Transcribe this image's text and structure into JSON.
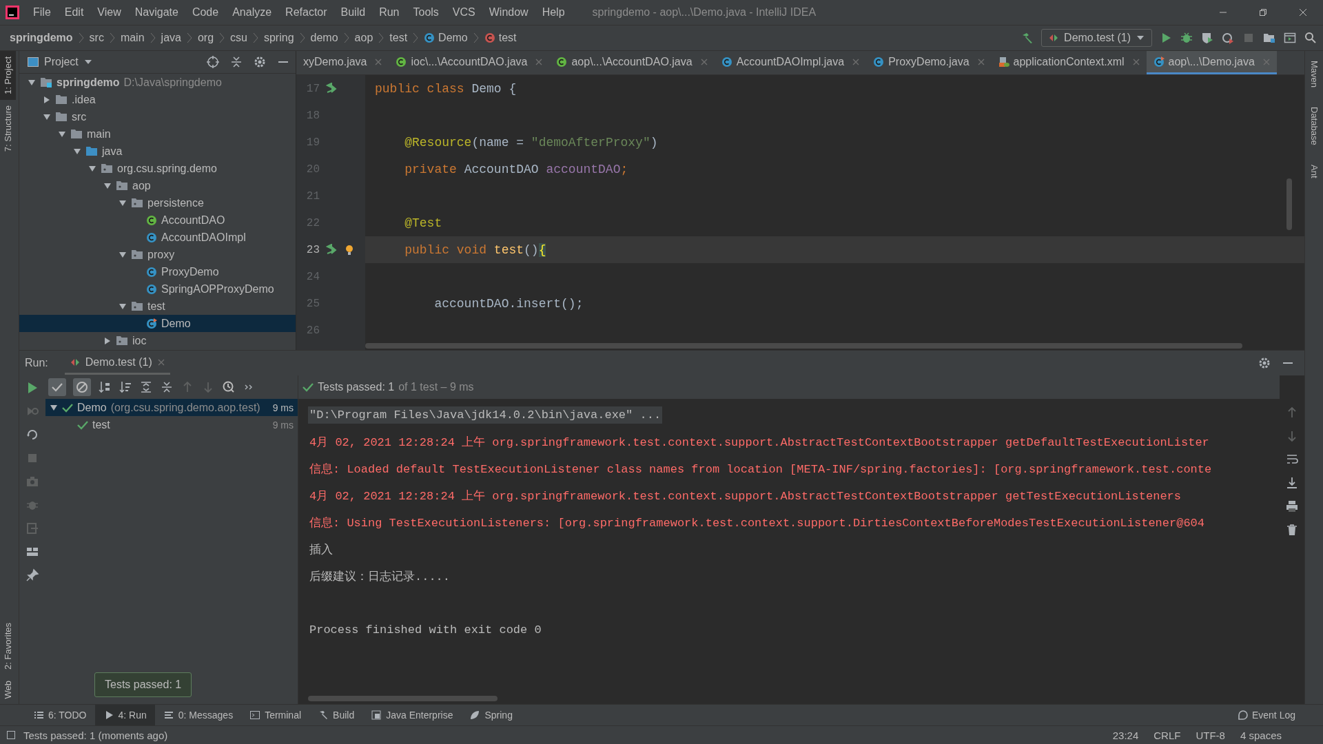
{
  "window": {
    "title": "springdemo - aop\\...\\Demo.java - IntelliJ IDEA"
  },
  "menu": [
    "File",
    "Edit",
    "View",
    "Navigate",
    "Code",
    "Analyze",
    "Refactor",
    "Build",
    "Run",
    "Tools",
    "VCS",
    "Window",
    "Help"
  ],
  "breadcrumbs": [
    {
      "label": "springdemo",
      "kind": "text"
    },
    {
      "label": "src",
      "kind": "text"
    },
    {
      "label": "main",
      "kind": "text"
    },
    {
      "label": "java",
      "kind": "text"
    },
    {
      "label": "org",
      "kind": "text"
    },
    {
      "label": "csu",
      "kind": "text"
    },
    {
      "label": "spring",
      "kind": "text"
    },
    {
      "label": "demo",
      "kind": "text"
    },
    {
      "label": "aop",
      "kind": "text"
    },
    {
      "label": "test",
      "kind": "text"
    },
    {
      "label": "Demo",
      "kind": "class"
    },
    {
      "label": "test",
      "kind": "method"
    }
  ],
  "run_config": "Demo.test (1)",
  "left_tool_windows": [
    {
      "label": "1: Project",
      "selected": true
    },
    {
      "label": "7: Structure",
      "selected": false
    }
  ],
  "left_tool_windows_bottom": [
    {
      "label": "2: Favorites",
      "selected": false
    },
    {
      "label": "Web",
      "selected": false
    }
  ],
  "right_tool_windows": [
    "Maven",
    "Database",
    "Ant"
  ],
  "project": {
    "title": "Project",
    "tree": [
      {
        "label": "springdemo",
        "path": "D:\\Java\\springdemo",
        "kind": "module",
        "expanded": true,
        "selected": false,
        "children": [
          {
            "label": ".idea",
            "kind": "folder",
            "expanded": false,
            "selected": false
          },
          {
            "label": "src",
            "kind": "folder",
            "expanded": true,
            "selected": false,
            "children": [
              {
                "label": "main",
                "kind": "folder",
                "expanded": true,
                "selected": false,
                "children": [
                  {
                    "label": "java",
                    "kind": "source",
                    "expanded": true,
                    "selected": false,
                    "children": [
                      {
                        "label": "org.csu.spring.demo",
                        "kind": "package",
                        "expanded": true,
                        "selected": false,
                        "children": [
                          {
                            "label": "aop",
                            "kind": "package",
                            "expanded": true,
                            "selected": false,
                            "children": [
                              {
                                "label": "persistence",
                                "kind": "package",
                                "expanded": true,
                                "selected": false,
                                "children": [
                                  {
                                    "label": "AccountDAO",
                                    "kind": "interface",
                                    "selected": false
                                  },
                                  {
                                    "label": "AccountDAOImpl",
                                    "kind": "class",
                                    "selected": false
                                  }
                                ]
                              },
                              {
                                "label": "proxy",
                                "kind": "package",
                                "expanded": true,
                                "selected": false,
                                "children": [
                                  {
                                    "label": "ProxyDemo",
                                    "kind": "class",
                                    "selected": false
                                  },
                                  {
                                    "label": "SpringAOPProxyDemo",
                                    "kind": "class",
                                    "selected": false
                                  }
                                ]
                              },
                              {
                                "label": "test",
                                "kind": "package",
                                "expanded": true,
                                "selected": false,
                                "children": [
                                  {
                                    "label": "Demo",
                                    "kind": "testclass",
                                    "selected": true
                                  }
                                ]
                              }
                            ]
                          },
                          {
                            "label": "ioc",
                            "kind": "package",
                            "expanded": false,
                            "selected": false
                          }
                        ]
                      }
                    ]
                  }
                ]
              }
            ]
          }
        ]
      }
    ]
  },
  "editor_tabs": [
    {
      "label": "xyDemo.java",
      "kind": "plain",
      "selected": false
    },
    {
      "label": "ioc\\...\\AccountDAO.java",
      "kind": "interface",
      "selected": false
    },
    {
      "label": "aop\\...\\AccountDAO.java",
      "kind": "interface",
      "selected": false
    },
    {
      "label": "AccountDAOImpl.java",
      "kind": "class",
      "selected": false
    },
    {
      "label": "ProxyDemo.java",
      "kind": "class",
      "selected": false
    },
    {
      "label": "applicationContext.xml",
      "kind": "xml",
      "selected": false
    },
    {
      "label": "aop\\...\\Demo.java",
      "kind": "testclass",
      "selected": true
    }
  ],
  "code_lines": [
    {
      "number": "17",
      "run_marker": true,
      "bulb": false,
      "current": false,
      "tokens": [
        {
          "text": "public class ",
          "kind": "keyword"
        },
        {
          "text": "Demo {",
          "kind": "plain"
        }
      ]
    },
    {
      "number": "18",
      "run_marker": false,
      "bulb": false,
      "current": false
    },
    {
      "number": "19",
      "run_marker": false,
      "bulb": false,
      "current": false,
      "tokens": [
        {
          "text": "    @Resource",
          "kind": "annotation"
        },
        {
          "text": "(name = ",
          "kind": "plain"
        },
        {
          "text": "\"demoAfterProxy\"",
          "kind": "string"
        },
        {
          "text": ")",
          "kind": "plain"
        }
      ]
    },
    {
      "number": "20",
      "run_marker": false,
      "bulb": false,
      "current": false,
      "tokens": [
        {
          "text": "    private ",
          "kind": "keyword"
        },
        {
          "text": "AccountDAO ",
          "kind": "plain"
        },
        {
          "text": "accountDAO",
          "kind": "field"
        },
        {
          "text": ";",
          "kind": "keyword"
        }
      ]
    },
    {
      "number": "21",
      "run_marker": false,
      "bulb": false,
      "current": false
    },
    {
      "number": "22",
      "run_marker": false,
      "bulb": false,
      "current": false,
      "tokens": [
        {
          "text": "    @Test",
          "kind": "annotation"
        }
      ]
    },
    {
      "number": "23",
      "run_marker": true,
      "bulb": true,
      "current": true,
      "tokens": [
        {
          "text": "    public void ",
          "kind": "keyword"
        },
        {
          "text": "test",
          "kind": "method"
        },
        {
          "text": "()",
          "kind": "plain"
        },
        {
          "text": "{",
          "kind": "brace"
        }
      ]
    },
    {
      "number": "24",
      "run_marker": false,
      "bulb": false,
      "current": false
    },
    {
      "number": "25",
      "run_marker": false,
      "bulb": false,
      "current": false,
      "tokens": [
        {
          "text": "        accountDAO.insert();",
          "kind": "plain"
        }
      ]
    },
    {
      "number": "26",
      "run_marker": false,
      "bulb": false,
      "current": false
    }
  ],
  "run_panel": {
    "label": "Run:",
    "tab": "Demo.test (1)",
    "status": "Tests passed: 1",
    "status_detail": "of 1 test – 9 ms",
    "tests": [
      {
        "label": "Demo",
        "detail": "(org.csu.spring.demo.aop.test)",
        "time": "9 ms",
        "selected": true,
        "children": [
          {
            "label": "test",
            "time": "9 ms",
            "selected": false
          }
        ]
      }
    ],
    "console": [
      {
        "kind": "command",
        "text": "\"D:\\Program Files\\Java\\jdk14.0.2\\bin\\java.exe\" ..."
      },
      {
        "kind": "error",
        "text": "4月 02, 2021 12:28:24 上午 org.springframework.test.context.support.AbstractTestContextBootstrapper getDefaultTestExecutionLister"
      },
      {
        "kind": "error",
        "text": "信息: Loaded default TestExecutionListener class names from location [META-INF/spring.factories]: [org.springframework.test.conte"
      },
      {
        "kind": "error",
        "text": "4月 02, 2021 12:28:24 上午 org.springframework.test.context.support.AbstractTestContextBootstrapper getTestExecutionListeners"
      },
      {
        "kind": "error",
        "text": "信息: Using TestExecutionListeners: [org.springframework.test.context.support.DirtiesContextBeforeModesTestExecutionListener@604"
      },
      {
        "kind": "output",
        "text": "插入"
      },
      {
        "kind": "output",
        "text": "后缀建议：日志记录....."
      },
      {
        "kind": "blank"
      },
      {
        "kind": "output",
        "text": "Process finished with exit code 0"
      }
    ],
    "tooltip": "Tests passed: 1"
  },
  "bottom_tabs": [
    {
      "label": "6: TODO",
      "kind": "list",
      "selected": false
    },
    {
      "label": "4: Run",
      "kind": "play",
      "selected": true
    },
    {
      "label": "0: Messages",
      "kind": "messages",
      "selected": false
    },
    {
      "label": "Terminal",
      "kind": "terminal",
      "selected": false
    },
    {
      "label": "Build",
      "kind": "hammer",
      "selected": false
    },
    {
      "label": "Java Enterprise",
      "kind": "enterprise",
      "selected": false
    },
    {
      "label": "Spring",
      "kind": "leaf",
      "selected": false
    }
  ],
  "event_log": "Event Log",
  "status_bar": {
    "message": "Tests passed: 1 (moments ago)",
    "items": [
      "23:24",
      "CRLF",
      "UTF-8",
      "4 spaces"
    ]
  }
}
